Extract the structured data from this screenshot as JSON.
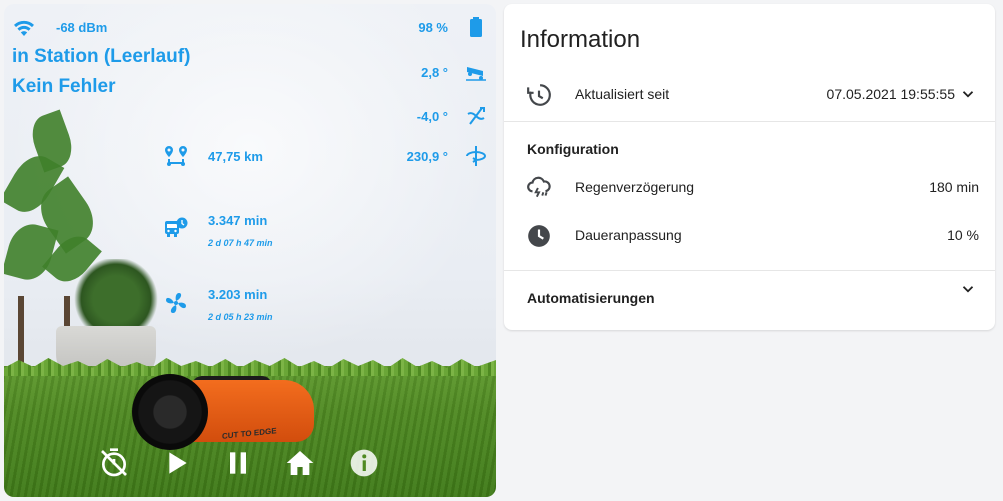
{
  "mower": {
    "rssi": "-68 dBm",
    "status": "in Station (Leerlauf)",
    "error": "Kein Fehler",
    "battery": "98 %",
    "pitch": "2,8 °",
    "roll": "-4,0 °",
    "yaw": "230,9 °",
    "distance": "47,75 km",
    "worktime_total": "3.347 min",
    "worktime_total_sub": "2 d 07 h 47 min",
    "blade_time": "3.203 min",
    "blade_time_sub": "2 d 05 h 23 min",
    "accent_color": "#1e9be9",
    "icons": {
      "wifi": "wifi-icon",
      "battery": "battery-icon",
      "pitch": "pitch-icon",
      "roll": "roll-icon",
      "yaw": "yaw-icon",
      "distance": "distance-icon",
      "worktime": "bus-clock-icon",
      "blade": "fan-icon"
    },
    "controls": [
      "timer-off-icon",
      "play-icon",
      "pause-icon",
      "home-icon",
      "info-icon"
    ]
  },
  "info": {
    "title": "Information",
    "updated_label": "Aktualisiert seit",
    "updated_value": "07.05.2021 19:55:55",
    "config_title": "Konfiguration",
    "rain_delay_label": "Regenverzögerung",
    "rain_delay_value": "180 min",
    "time_extension_label": "Daueranpassung",
    "time_extension_value": "10 %",
    "automations_title": "Automatisierungen"
  }
}
